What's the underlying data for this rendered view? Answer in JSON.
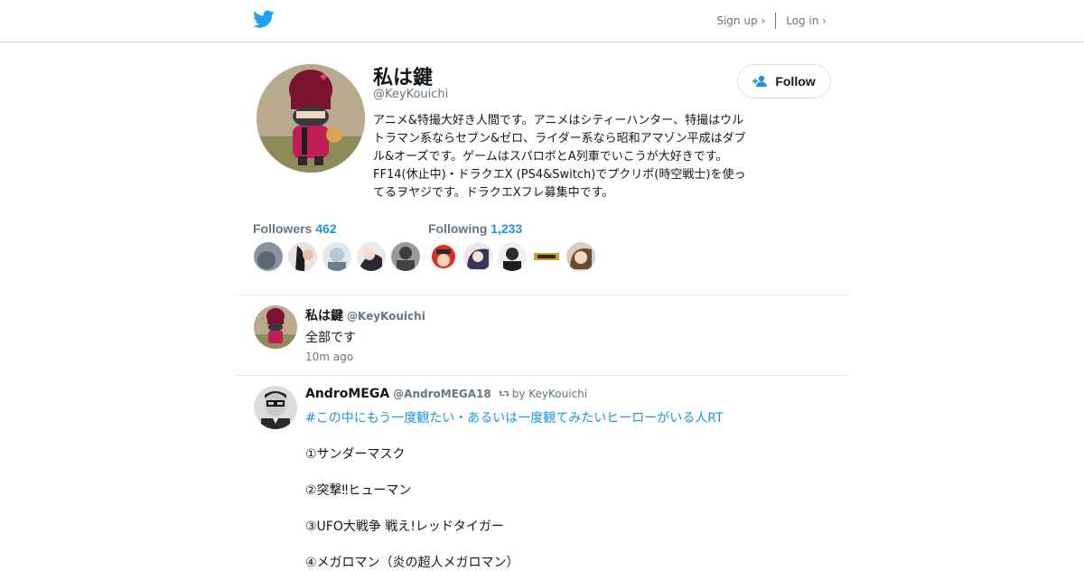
{
  "header": {
    "signup_label": "Sign up ›",
    "login_label": "Log in ›"
  },
  "profile": {
    "name": "私は鍵",
    "handle": "@KeyKouichi",
    "bio": "アニメ&特撮大好き人間です。アニメはシティーハンター、特撮はウルトラマン系ならセブン&ゼロ、ライダー系なら昭和アマゾン平成はダブル&オーズです。ゲームはスパロボとA列車でいこうが大好きです。FF14(休止中)・ドラクエX (PS4&Switch)でプクリポ(時空戦士)を使ってるヲヤジです。ドラクエXフレ募集中です。",
    "follow_label": "Follow",
    "followers_label": "Followers",
    "followers_count": "462",
    "following_label": "Following",
    "following_count": "1,233"
  },
  "tweets": [
    {
      "name": "私は鍵",
      "handle": "@KeyKouichi",
      "text": "全部です",
      "time": "10m ago"
    },
    {
      "name": "AndroMEGA",
      "handle": "@AndroMEGA18",
      "retweet_by": "by KeyKouichi",
      "hashtag": "#この中にもう一度観たい・あるいは一度観てみたいヒーローがいる人RT",
      "lines": [
        "①サンダーマスク",
        "②突撃‼ヒューマン",
        "③UFO大戦争 戦え!レッドタイガー",
        "④メガロマン（炎の超人メガロマン）"
      ]
    }
  ],
  "colors": {
    "accent": "#1b95e0",
    "muted": "#66757f",
    "text": "#14171a",
    "divider": "#e6ecf0"
  },
  "icons": {
    "brand": "twitter-bird-icon",
    "follow": "add-person-icon",
    "retweet": "retweet-icon"
  }
}
